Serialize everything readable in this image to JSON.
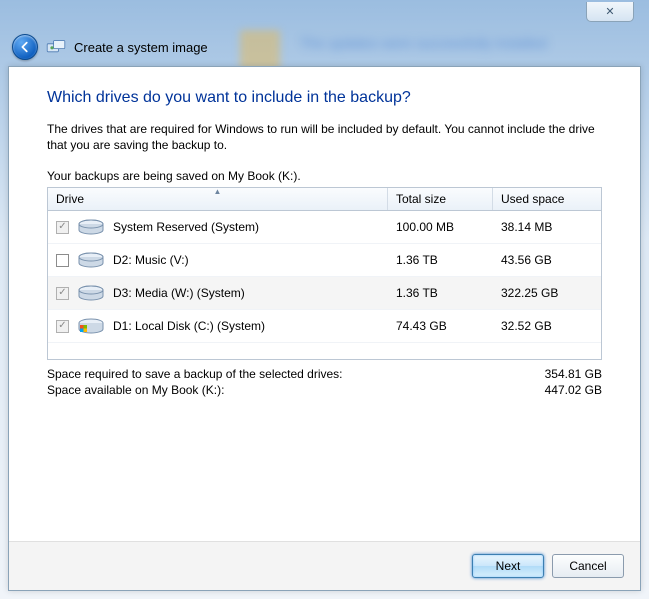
{
  "window": {
    "close_glyph": "✕",
    "back_tooltip": "Back",
    "icon_name": "system-image-wizard-icon",
    "title": "Create a system image",
    "bg_text": "The updates were successfully installed"
  },
  "page": {
    "heading": "Which drives do you want to include in the backup?",
    "description": "The drives that are required for Windows to run will be included by default. You cannot include the drive that you are saving the backup to.",
    "save_location": "Your backups are being saved on My Book (K:).",
    "columns": {
      "drive": "Drive",
      "total_size": "Total size",
      "used_space": "Used space"
    },
    "drives": [
      {
        "checked": true,
        "disabled": true,
        "icon": "drive",
        "label": "System Reserved (System)",
        "total": "100.00 MB",
        "used": "38.14 MB",
        "selected": false
      },
      {
        "checked": false,
        "disabled": false,
        "icon": "drive",
        "label": "D2: Music (V:)",
        "total": "1.36 TB",
        "used": "43.56 GB",
        "selected": false
      },
      {
        "checked": true,
        "disabled": true,
        "icon": "drive",
        "label": "D3: Media (W:) (System)",
        "total": "1.36 TB",
        "used": "322.25 GB",
        "selected": true
      },
      {
        "checked": true,
        "disabled": true,
        "icon": "osdrive",
        "label": "D1: Local Disk (C:) (System)",
        "total": "74.43 GB",
        "used": "32.52 GB",
        "selected": false
      }
    ],
    "summary": {
      "required_label": "Space required to save a backup of the selected drives:",
      "required_value": "354.81 GB",
      "available_label": "Space available on My Book (K:):",
      "available_value": "447.02 GB"
    }
  },
  "footer": {
    "next": "Next",
    "cancel": "Cancel"
  }
}
